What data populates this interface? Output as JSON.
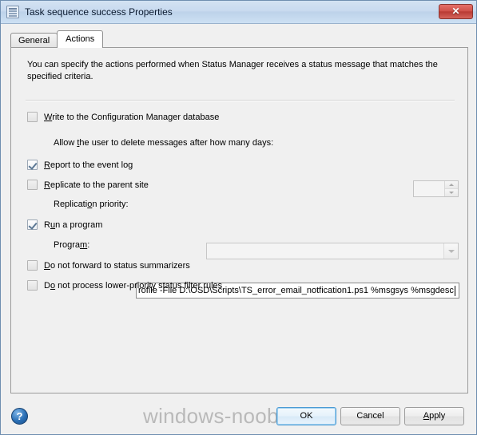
{
  "window": {
    "title": "Task sequence success Properties",
    "icon": "properties-window-icon",
    "close_label": "✕"
  },
  "tabs": [
    {
      "label": "General",
      "active": false
    },
    {
      "label": "Actions",
      "active": true
    }
  ],
  "main": {
    "intro": "You can specify the actions performed when Status Manager receives a status message that matches the specified criteria.",
    "options": [
      {
        "name": "write-to-database",
        "label": "Write to the Configuration Manager database",
        "accel": "W",
        "checked": false
      },
      {
        "name": "report-to-event-log",
        "label": "Report to the event log",
        "accel": "R",
        "checked": true
      },
      {
        "name": "replicate-to-parent-site",
        "label": "Replicate to the parent site",
        "accel": "R",
        "checked": false
      },
      {
        "name": "run-a-program",
        "label": "Run a program",
        "accel": "u",
        "checked": true
      },
      {
        "name": "do-not-forward",
        "label": "Do not forward to status summarizers",
        "accel": "D",
        "checked": false
      },
      {
        "name": "do-not-process-lower-priority",
        "label": "Do not process lower-priority status filter rules",
        "accel": "o",
        "checked": false
      }
    ],
    "delete_days": {
      "label_before": "Allow ",
      "label_accel": "t",
      "label_after": "he user to delete messages after how many days:",
      "value": "",
      "enabled": false
    },
    "replication_priority": {
      "label_before": "Replicati",
      "label_accel": "o",
      "label_after": "n priority:",
      "value": "",
      "enabled": false
    },
    "program": {
      "label_before": "Progra",
      "label_accel": "m",
      "label_after": ":",
      "value": "rofile -File D:\\OSD\\Scripts\\TS_error_email_notfication1.ps1 %msgsys %msgdesc",
      "enabled": true
    }
  },
  "watermark": "windows-noob.com",
  "footer": {
    "help_label": "?",
    "buttons": [
      {
        "name": "ok",
        "label": "OK",
        "accel": "",
        "default": true
      },
      {
        "name": "cancel",
        "label": "Cancel",
        "accel": "",
        "default": false
      },
      {
        "name": "apply",
        "label": "Apply",
        "accel": "A",
        "default": false
      }
    ]
  },
  "colors": {
    "titlebar": "#c8daef",
    "close_button": "#c34a43",
    "dialog_face": "#f0f0f0",
    "accent_focus": "#4a9ad4",
    "checkmark": "#5c7894",
    "watermark": "#b9b9b9"
  }
}
